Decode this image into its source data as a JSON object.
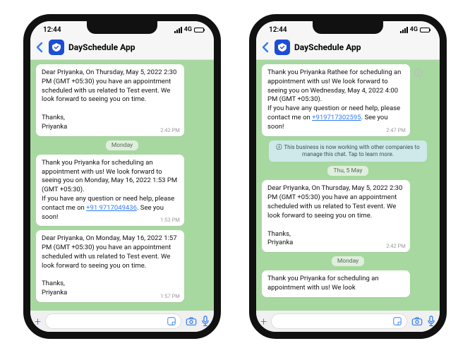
{
  "status": {
    "time": "12:44",
    "network": "4G"
  },
  "header": {
    "app_name": "DaySchedule App"
  },
  "phones": [
    {
      "items": [
        {
          "type": "bubble",
          "key": "p0m0",
          "time": "2:42 PM",
          "text": "Dear Priyanka, On Thursday, May 5, 2022 2:30 PM (GMT +05:30) you have an appointment scheduled with us related to Test event. We look forward to seeing you on time.\n\nThanks,\nPriyanka"
        },
        {
          "type": "day",
          "key": "p0d0",
          "label": "Monday"
        },
        {
          "type": "bubble",
          "key": "p0m1",
          "time": "1:53 PM",
          "text_pre": "Thank you Priyanka for scheduling an appointment with us! We look forward to seeing you on Monday, May 16, 2022 1:53 PM (GMT +05:30).\nIf you have any question or need help, please contact me on ",
          "link": "+91 9717049436",
          "text_post": ". See you soon!"
        },
        {
          "type": "bubble",
          "key": "p0m2",
          "time": "1:57 PM",
          "text": "Dear Priyanka, On Monday, May 16, 2022 1:57 PM (GMT +05:30) you have an appointment scheduled with us related to Test event. We look forward to seeing you on time.\n\nThanks,\nPriyanka"
        }
      ]
    },
    {
      "items": [
        {
          "type": "bubble",
          "key": "p1m0",
          "time": "2:47 PM",
          "has_info": true,
          "text_pre": "Thank you Priyanka Rathee for scheduling an appointment with us! We look forward to seeing you on Wednesday, May 4, 2022 4:00 PM (GMT +05:30).\nIf you have any question or need help, please contact me on ",
          "link": "+919717302595",
          "text_post": ". See you soon!"
        },
        {
          "type": "info",
          "key": "p1i0",
          "text": "This business is now working with other companies to manage this chat. Tap to learn more."
        },
        {
          "type": "day",
          "key": "p1d0",
          "label": "Thu, 5 May"
        },
        {
          "type": "bubble",
          "key": "p1m1",
          "time": "2:42 PM",
          "text": "Dear Priyanka, On Thursday, May 5, 2022 2:30 PM (GMT +05:30) you have an appointment scheduled with us related to Test event. We look forward to seeing you on time.\n\nThanks,\nPriyanka"
        },
        {
          "type": "day",
          "key": "p1d1",
          "label": "Monday"
        },
        {
          "type": "bubble",
          "key": "p1m2",
          "time": "",
          "text": "Thank you Priyanka for scheduling an appointment with us! We look"
        }
      ]
    }
  ]
}
